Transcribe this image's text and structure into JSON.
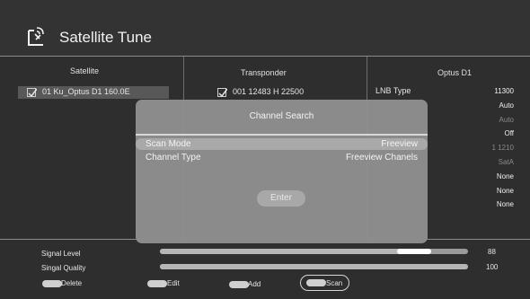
{
  "header": {
    "title": "Satellite Tune",
    "icon": "satellite-dish-icon"
  },
  "columns": {
    "satellite": {
      "heading": "Satellite",
      "selected_item": "01 Ku_Optus D1 160.0E"
    },
    "transponder": {
      "heading": "Transponder",
      "selected_item": "001  12483 H 22500"
    },
    "details": {
      "heading": "Optus D1",
      "lnb_type_label": "LNB Type",
      "values": [
        {
          "text": "11300",
          "dim": false
        },
        {
          "text": "Auto",
          "dim": false
        },
        {
          "text": "Auto",
          "dim": true
        },
        {
          "text": "Off",
          "dim": false
        },
        {
          "text": "1 1210",
          "dim": true
        },
        {
          "text": "SatA",
          "dim": true
        },
        {
          "text": "None",
          "dim": false
        },
        {
          "text": "None",
          "dim": false
        },
        {
          "text": "None",
          "dim": false
        }
      ]
    }
  },
  "dialog": {
    "title": "Channel Search",
    "rows": [
      {
        "label": "Scan Mode",
        "value": "Freeview",
        "highlighted": true
      },
      {
        "label": "Channel Type",
        "value": "Freeview Chanels",
        "highlighted": false
      }
    ],
    "enter_label": "Enter"
  },
  "signal": {
    "level_label": "Signal Level",
    "level_value": "88",
    "level_fraction": 0.88,
    "quality_label": "Singal Quality",
    "quality_value": "100",
    "quality_fraction": 1.0
  },
  "keys": {
    "delete": "Delete",
    "edit": "Edit",
    "add": "Add",
    "scan": "Scan"
  },
  "colors": {
    "background": "#2e2e2e",
    "dialog": "#909090",
    "highlight": "#a9a9a9"
  }
}
